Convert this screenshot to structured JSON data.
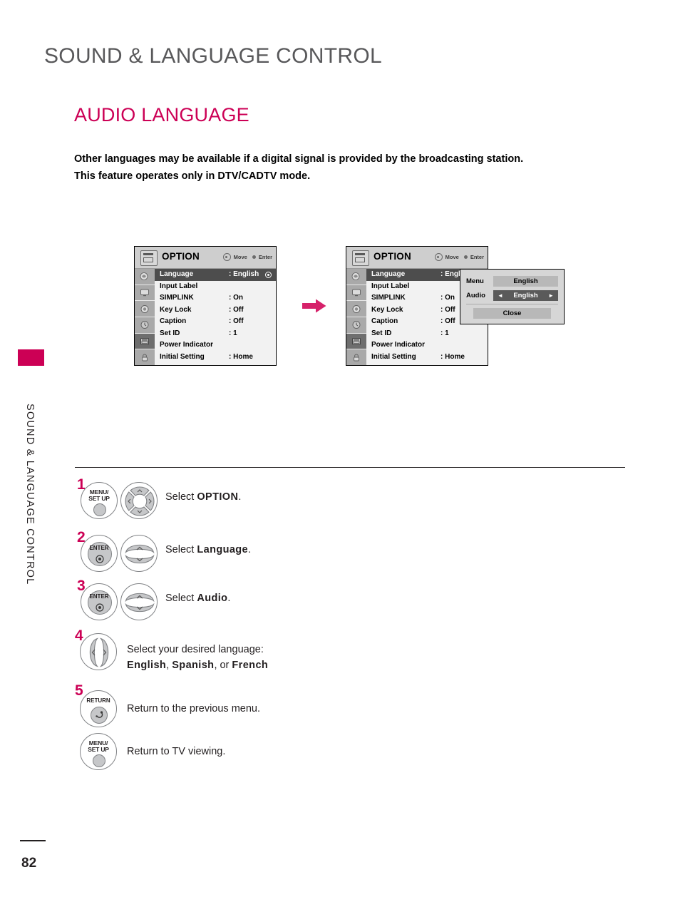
{
  "page": {
    "title": "SOUND & LANGUAGE CONTROL",
    "section_title": "AUDIO LANGUAGE",
    "number": "82",
    "side_tab_text": "SOUND & LANGUAGE CONTROL",
    "accent_color": "#cc0055",
    "title_color": "#58585a"
  },
  "intro": {
    "line1": "Other languages may be available if a digital signal is provided by the broadcasting station.",
    "line2": "This feature operates only in DTV/CADTV mode."
  },
  "osd": {
    "title": "OPTION",
    "hint_move": "Move",
    "hint_enter": "Enter",
    "icons": [
      "picture-icon",
      "screen-icon",
      "audio-icon",
      "time-icon",
      "option-icon",
      "lock-icon"
    ],
    "active_icon_index": 4,
    "rows": [
      {
        "label": "Language",
        "value": ": English",
        "selected": true,
        "enter_dot": true
      },
      {
        "label": "Input Label",
        "value": "",
        "selected": false,
        "enter_dot": false
      },
      {
        "label": "SIMPLINK",
        "value": ": On",
        "selected": false,
        "enter_dot": false
      },
      {
        "label": "Key Lock",
        "value": ": Off",
        "selected": false,
        "enter_dot": false
      },
      {
        "label": "Caption",
        "value": ": Off",
        "selected": false,
        "enter_dot": false
      },
      {
        "label": "Set ID",
        "value": ": 1",
        "selected": false,
        "enter_dot": false
      },
      {
        "label": "Power Indicator",
        "value": "",
        "selected": false,
        "enter_dot": false
      },
      {
        "label": "Initial Setting",
        "value": ": Home",
        "selected": false,
        "enter_dot": false
      }
    ],
    "rows_truncated_value": ": Engl"
  },
  "popup": {
    "menu_label": "Menu",
    "menu_value": "English",
    "audio_label": "Audio",
    "audio_value": "English",
    "arrow_left": "◄",
    "arrow_right": "►",
    "close_label": "Close"
  },
  "steps": [
    {
      "number": "1",
      "buttons": [
        "MENU/ SET UP",
        "dpad"
      ],
      "text_prefix": "Select ",
      "text_bold": "OPTION",
      "text_suffix": "."
    },
    {
      "number": "2",
      "buttons": [
        "ENTER",
        "updown"
      ],
      "text_prefix": "Select ",
      "text_bold": "Language",
      "text_suffix": "."
    },
    {
      "number": "3",
      "buttons": [
        "ENTER",
        "updown"
      ],
      "text_prefix": "Select ",
      "text_bold": "Audio",
      "text_suffix": "."
    },
    {
      "number": "4",
      "buttons": [
        "leftright"
      ],
      "line1": "Select  your  desired  language:",
      "bold1": "English",
      "sep1": ", ",
      "bold2": "Spanish",
      "sep2": ", or ",
      "bold3": "French"
    },
    {
      "number": "5",
      "buttons": [
        "RETURN"
      ],
      "text": "Return to the previous menu."
    },
    {
      "number": "",
      "buttons": [
        "MENU/ SET UP"
      ],
      "text": "Return to TV viewing."
    }
  ],
  "remote_labels": {
    "menu_line1": "MENU/",
    "menu_line2": "SET UP",
    "enter": "ENTER",
    "return": "RETURN"
  }
}
